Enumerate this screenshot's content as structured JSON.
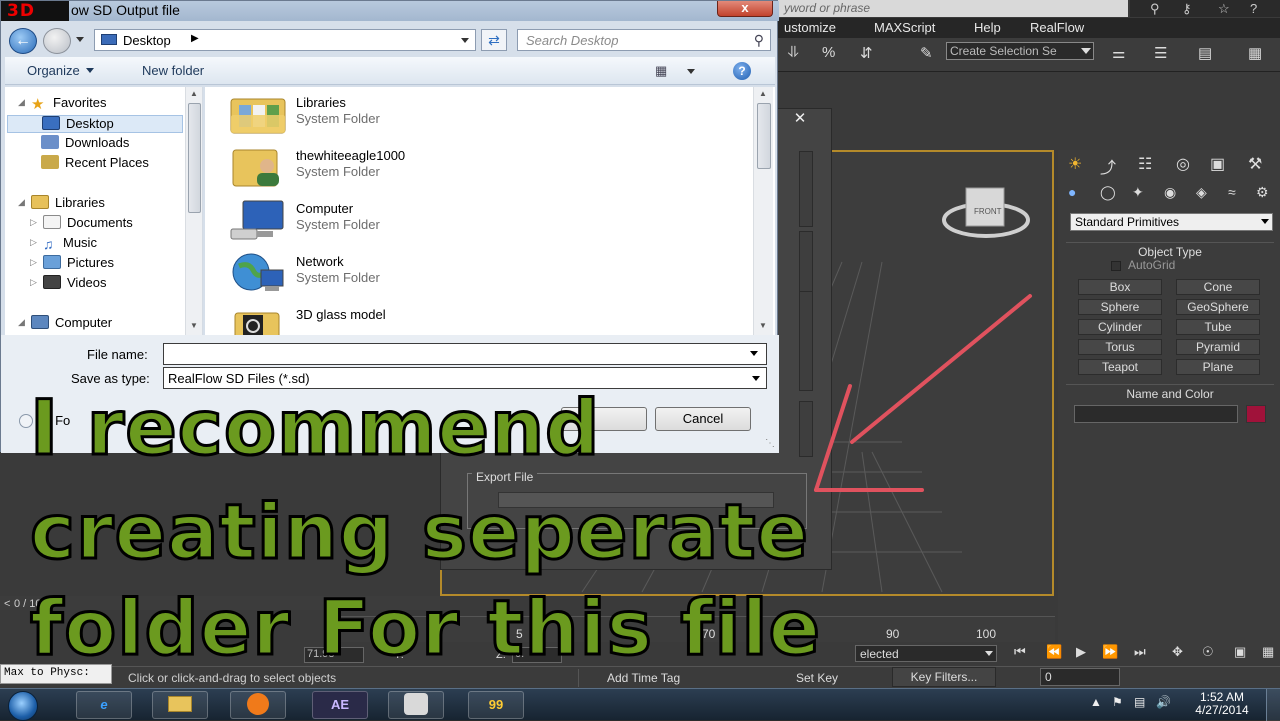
{
  "dialog": {
    "logo": "3D",
    "title": "ow SD Output file",
    "close_label": "x",
    "address": "Desktop",
    "search_placeholder": "Search Desktop",
    "organize_label": "Organize",
    "new_folder_label": "New folder",
    "file_name_label": "File name:",
    "file_name_value": "",
    "save_as_type_label": "Save as type:",
    "save_as_type_value": "RealFlow SD Files (*.sd)",
    "hide_folders_label": "de Fo",
    "save_label": "",
    "cancel_label": "Cancel"
  },
  "nav_pane": {
    "items": [
      {
        "label": "Favorites",
        "icon": "star-icon",
        "level": 0
      },
      {
        "label": "Desktop",
        "icon": "desktop-icon",
        "level": 1,
        "selected": true
      },
      {
        "label": "Downloads",
        "icon": "downloads-icon",
        "level": 1
      },
      {
        "label": "Recent Places",
        "icon": "recent-places-icon",
        "level": 1
      },
      {
        "label": "Libraries",
        "icon": "libraries-icon",
        "level": 0
      },
      {
        "label": "Documents",
        "icon": "documents-icon",
        "level": 1
      },
      {
        "label": "Music",
        "icon": "music-icon",
        "level": 1
      },
      {
        "label": "Pictures",
        "icon": "pictures-icon",
        "level": 1
      },
      {
        "label": "Videos",
        "icon": "videos-icon",
        "level": 1
      },
      {
        "label": "Computer",
        "icon": "computer-icon",
        "level": 0
      }
    ]
  },
  "files": [
    {
      "name": "Libraries",
      "type": "System Folder",
      "icon": "libraries-folder-icon"
    },
    {
      "name": "thewhiteeagle1000",
      "type": "System Folder",
      "icon": "user-folder-icon"
    },
    {
      "name": "Computer",
      "type": "System Folder",
      "icon": "computer-icon"
    },
    {
      "name": "Network",
      "type": "System Folder",
      "icon": "network-icon"
    },
    {
      "name": "3D glass model",
      "type": "",
      "icon": "folder-icon"
    }
  ],
  "max": {
    "search_placeholder": "yword or phrase",
    "menu": [
      "ustomize",
      "MAXScript",
      "Help",
      "RealFlow"
    ],
    "selection_set_placeholder": "Create Selection Se",
    "primitives_dropdown": "Standard Primitives",
    "object_type_title": "Object Type",
    "autogrid_label": "AutoGrid",
    "object_buttons": [
      "Box",
      "Cone",
      "Sphere",
      "GeoSphere",
      "Cylinder",
      "Tube",
      "Torus",
      "Pyramid",
      "Teapot",
      "Plane"
    ],
    "name_color_title": "Name and Color",
    "export_file_label": "Export File",
    "frame_counter": "0 / 100",
    "timeline_ticks": [
      "5",
      "70",
      "90",
      "100"
    ],
    "coords": {
      "x_value": "71.98",
      "y_label": "Y:",
      "z_label": "Z:",
      "z_value": "0."
    },
    "selected_label": "elected",
    "maxscript_mini": "Max to Physc:",
    "status_prompt": "Click or click-and-drag to select objects",
    "add_time_tag": "Add Time Tag",
    "set_key": "Set Key",
    "key_filters": "Key Filters...",
    "frame_value": "0"
  },
  "caption": {
    "line1": "I recommend",
    "line2": "creating seperate",
    "line3": "folder For this file"
  },
  "taskbar": {
    "apps": [
      "e",
      "",
      "",
      "AE",
      "",
      "99"
    ],
    "time": "1:52 AM",
    "date": "4/27/2014"
  }
}
